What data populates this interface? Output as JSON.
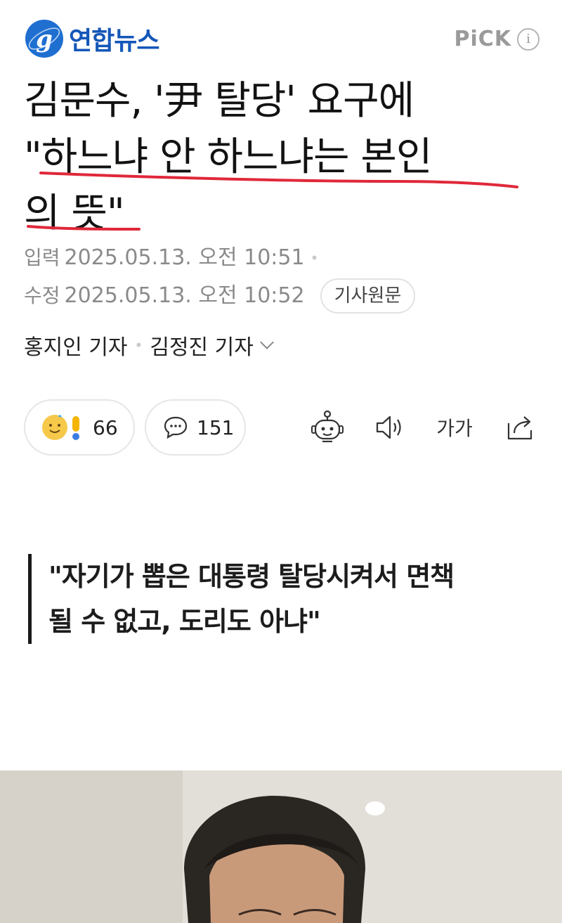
{
  "brand": {
    "name": "연합뉴스",
    "pick_label": "PiCK",
    "info_label": "i",
    "accent": "#1f6fd1"
  },
  "headline": {
    "line1": "김문수, '尹 탈당' 요구에",
    "line2": "\"하느냐 안 하느냐는 본인",
    "line3": "의 뜻\""
  },
  "meta": {
    "published_label": "입력",
    "published": "2025.05.13. 오전 10:51",
    "updated_label": "수정",
    "updated": "2025.05.13. 오전 10:52",
    "original_button": "기사원문"
  },
  "reporters": {
    "first": "홍지인 기자",
    "second": "김정진 기자"
  },
  "actions": {
    "reaction_count": "66",
    "comment_count": "151",
    "font_size_label": "가가"
  },
  "quote": {
    "line1": "\"자기가 뽑은 대통령 탈당시켜서 면책",
    "line2": "될 수 없고, 도리도 아냐\""
  }
}
